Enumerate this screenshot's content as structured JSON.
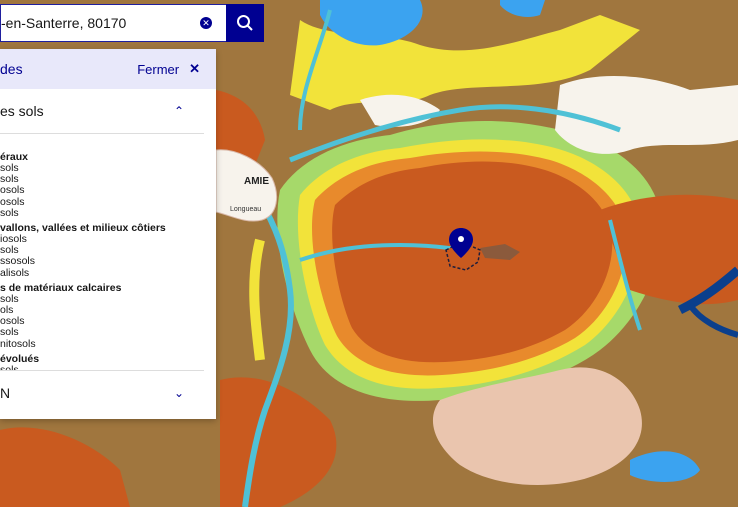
{
  "search": {
    "value": "-en-Santerre, 80170"
  },
  "panel": {
    "title": "des",
    "close_label": "Fermer",
    "section1_label": "es sols",
    "section2_label": "N",
    "groups": [
      {
        "title": "éraux",
        "items": [
          "sols",
          "sols",
          "osols",
          "osols",
          "sols"
        ]
      },
      {
        "title": "vallons, vallées et milieux côtiers",
        "items": [
          "iosols",
          "sols",
          "ssosols",
          "alisols"
        ]
      },
      {
        "title": "s de matériaux calcaires",
        "items": [
          "sols",
          "ols",
          "osols",
          "sols",
          "nitosols"
        ]
      },
      {
        "title": "évolués",
        "items": [
          "sols"
        ]
      }
    ]
  },
  "map": {
    "place_label": "AMIE",
    "place_sublabel": "Longueau",
    "colors": {
      "base": "#a0763e",
      "dark_orange": "#c95a1f",
      "orange": "#e88a2c",
      "yellow": "#f2e33a",
      "green": "#a6d96a",
      "cyan": "#4fc1d6",
      "blue": "#3ba3f0",
      "navy": "#0b3f8c",
      "pink": "#eac5ae",
      "white": "#f7f3ec",
      "marker": "#000091"
    }
  }
}
